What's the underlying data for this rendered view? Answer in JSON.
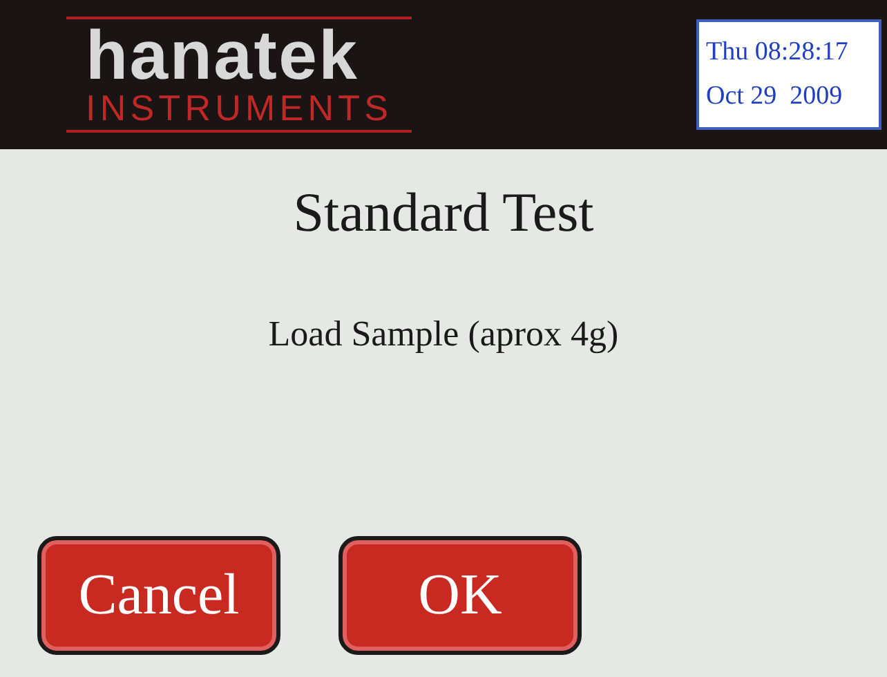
{
  "header": {
    "logo": "hanatek",
    "logo_subtitle": "INSTRUMENTS",
    "datetime": [
      "Thu 08:28:17",
      "Oct 29  2009"
    ]
  },
  "title": "Standard Test",
  "message": "Load Sample (aprox 4g)",
  "buttons": [
    "Cancel",
    "OK"
  ]
}
